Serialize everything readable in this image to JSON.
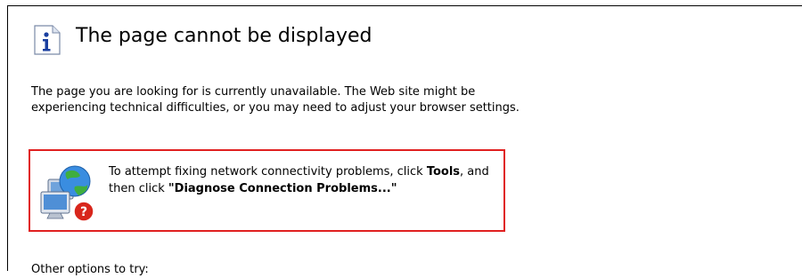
{
  "header": {
    "title": "The page cannot be displayed",
    "icon": "info-icon"
  },
  "body": {
    "message": "The page you are looking for is currently unavailable. The Web site might be experiencing technical difficulties, or you may need to adjust your browser settings."
  },
  "diagnose_box": {
    "icon": "network-diagnose-icon",
    "border_color": "#e02020",
    "text_prefix": "To attempt fixing network connectivity problems, click ",
    "tools_label": "Tools",
    "text_middle": ", and then click ",
    "diagnose_label": "\"Diagnose Connection Problems...\""
  },
  "other_options": {
    "label": "Other options to try:"
  }
}
